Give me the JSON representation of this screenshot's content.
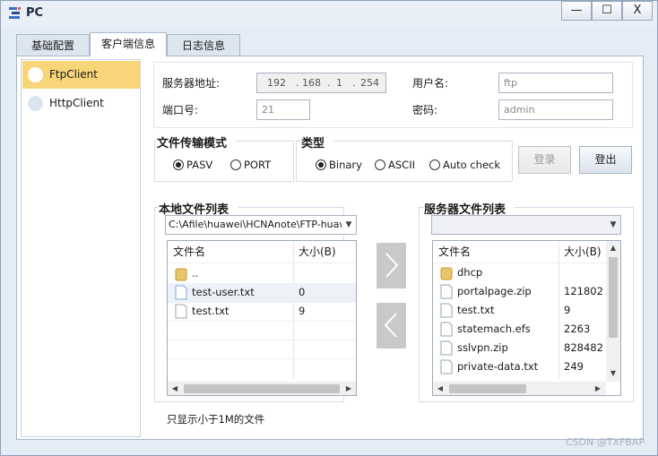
{
  "window": {
    "title": "PC",
    "controls": [
      "—",
      "☐",
      "X"
    ]
  },
  "tabs": [
    {
      "label": "基础配置",
      "active": false
    },
    {
      "label": "客户端信息",
      "active": true
    },
    {
      "label": "日志信息",
      "active": false
    }
  ],
  "sidebar": {
    "items": [
      {
        "label": "FtpClient",
        "active": true
      },
      {
        "label": "HttpClient",
        "active": false
      }
    ]
  },
  "server": {
    "address_label": "服务器地址:",
    "ip": [
      "192",
      "168",
      "1",
      "254"
    ],
    "username_label": "用户名:",
    "username_value": "ftp",
    "port_label": "端口号:",
    "port_value": "21",
    "password_label": "密码:",
    "password_value": "admin"
  },
  "transfer_mode": {
    "title": "文件传输模式",
    "options": [
      "PASV",
      "PORT"
    ],
    "selected": "PASV"
  },
  "type": {
    "title": "类型",
    "options": [
      "Binary",
      "ASCII",
      "Auto check"
    ],
    "selected": "Binary"
  },
  "buttons": {
    "login": "登录",
    "logout": "登出"
  },
  "local": {
    "title": "本地文件列表",
    "path": "C:\\Afile\\huawei\\HCNAnote\\FTP-huawei",
    "col_name": "文件名",
    "col_size": "大小(B)",
    "rows": [
      {
        "name": "..",
        "size": "",
        "type": "folder"
      },
      {
        "name": "test-user.txt",
        "size": "0",
        "type": "file-selected"
      },
      {
        "name": "test.txt",
        "size": "9",
        "type": "file"
      }
    ]
  },
  "remote": {
    "title": "服务器文件列表",
    "col_name": "文件名",
    "col_size": "大小(B)",
    "rows": [
      {
        "name": "dhcp",
        "size": "",
        "type": "folder"
      },
      {
        "name": "portalpage.zip",
        "size": "121802",
        "type": "file"
      },
      {
        "name": "test.txt",
        "size": "9",
        "type": "file"
      },
      {
        "name": "statemach.efs",
        "size": "2263",
        "type": "file"
      },
      {
        "name": "sslvpn.zip",
        "size": "828482",
        "type": "file"
      },
      {
        "name": "private-data.txt",
        "size": "249",
        "type": "file"
      }
    ]
  },
  "note": "只显示小于1M的文件",
  "watermark": "CSDN @TXFBAP"
}
